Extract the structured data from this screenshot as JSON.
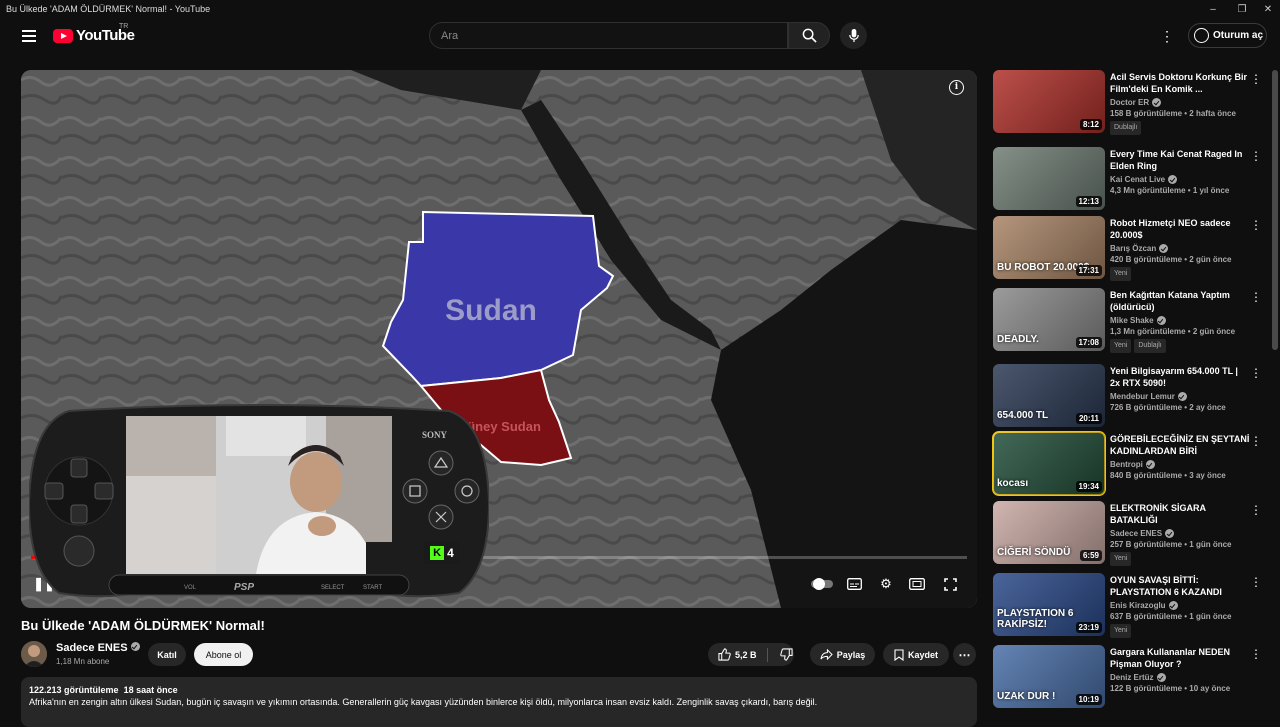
{
  "window": {
    "title": "Bu Ülkede 'ADAM ÖLDÜRMEK' Normal! - YouTube"
  },
  "masthead": {
    "logo_text": "YouTube",
    "country_code": "TR",
    "search_placeholder": "Ara",
    "signin_label": "Oturum aç"
  },
  "player": {
    "map_label_sudan": "Sudan",
    "map_label_south": "Güney Sudan",
    "psp_brand": "SONY",
    "psp_logo": "PSP",
    "psp_select": "SELECT",
    "psp_start": "START",
    "psp_vol": "VOL",
    "kick_count": "4",
    "progress": 0.012
  },
  "video": {
    "title": "Bu Ülkede 'ADAM ÖLDÜRMEK' Normal!",
    "channel": "Sadece ENES",
    "subscribers": "1,18 Mn abone",
    "join_label": "Katıl",
    "subscribe_label": "Abone ol",
    "likes": "5,2 B",
    "share_label": "Paylaş",
    "save_label": "Kaydet",
    "views": "122.213 görüntüleme",
    "age": "18 saat önce",
    "description": "Afrika'nın en zengin altın ülkesi Sudan, bugün iç savaşın ve yıkımın ortasında. Generallerin güç kavgası yüzünden binlerce kişi öldü, milyonlarca insan evsiz kaldı. Zenginlik savaş çıkardı, barış değil."
  },
  "recommendations": [
    {
      "title": "Acil Servis Doktoru Korkunç Bir Film'deki En Komik ...",
      "channel": "Doctor ER",
      "views": "158 B görüntüleme",
      "age": "2 hafta önce",
      "duration": "8:12",
      "badges": [
        "Dublajlı"
      ],
      "thumb_color": "#b0312b"
    },
    {
      "title": "Every Time Kai Cenat Raged In Elden Ring",
      "channel": "Kai Cenat Live",
      "views": "4,3 Mn görüntüleme",
      "age": "1 yıl önce",
      "duration": "12:13",
      "badges": [],
      "thumb_color": "#6f7d74"
    },
    {
      "title": "Robot Hizmetçi NEO sadece 20.000$",
      "channel": "Barış Özcan",
      "views": "420 B görüntüleme",
      "age": "2 gün önce",
      "duration": "17:31",
      "badges": [
        "Yeni"
      ],
      "thumb_color": "#a98466",
      "thumb_text": "BU ROBOT 20.000$"
    },
    {
      "title": "Ben Kağıttan Katana Yaptım (öldürücü)",
      "channel": "Mike Shake",
      "views": "1,3 Mn görüntüleme",
      "age": "2 gün önce",
      "duration": "17:08",
      "badges": [
        "Yeni",
        "Dublajlı"
      ],
      "thumb_color": "#8a8a8a",
      "thumb_text": "DEADLY."
    },
    {
      "title": "Yeni Bilgisayarım 654.000 TL | 2x RTX 5090!",
      "channel": "Mendebur Lemur",
      "views": "726 B görüntüleme",
      "age": "2 ay önce",
      "duration": "20:11",
      "badges": [],
      "thumb_color": "#2c3a55",
      "thumb_text": "654.000 TL"
    },
    {
      "title": "GÖREBİLECEĞİNİZ EN ŞEYTANİ KADINLARDAN BİRİ",
      "channel": "Bentropi",
      "views": "840 B görüntüleme",
      "age": "3 ay önce",
      "duration": "19:34",
      "badges": [],
      "thumb_color": "#234f3a",
      "thumb_text": "kocası"
    },
    {
      "title": "ELEKTRONİK SİGARA BATAKLIĞI",
      "channel": "Sadece ENES",
      "views": "257 B görüntüleme",
      "age": "1 gün önce",
      "duration": "6:59",
      "badges": [
        "Yeni"
      ],
      "thumb_color": "#c9a9a3",
      "thumb_text": "CİĞERİ SÖNDÜ"
    },
    {
      "title": "OYUN SAVAŞI BİTTİ: PLAYSTATION 6 KAZANDI",
      "channel": "Enis Kirazoglu",
      "views": "637 B görüntüleme",
      "age": "1 gün önce",
      "duration": "23:19",
      "badges": [
        "Yeni"
      ],
      "thumb_color": "#2b4a8a",
      "thumb_text": "PLAYSTATION 6 RAKİPSİZ!"
    },
    {
      "title": "Gargara Kullananlar NEDEN Pişman Oluyor ?",
      "channel": "Deniz Ertüz",
      "views": "122 B görüntüleme",
      "age": "10 ay önce",
      "duration": "10:19",
      "badges": [],
      "thumb_color": "#4a6fa8",
      "thumb_text": "UZAK DUR !"
    }
  ],
  "colors": {
    "accent": "#ff0000",
    "background": "#0f0f0f",
    "sudan_fill": "#3a37a8",
    "south_sudan_fill": "#7a0f14"
  }
}
